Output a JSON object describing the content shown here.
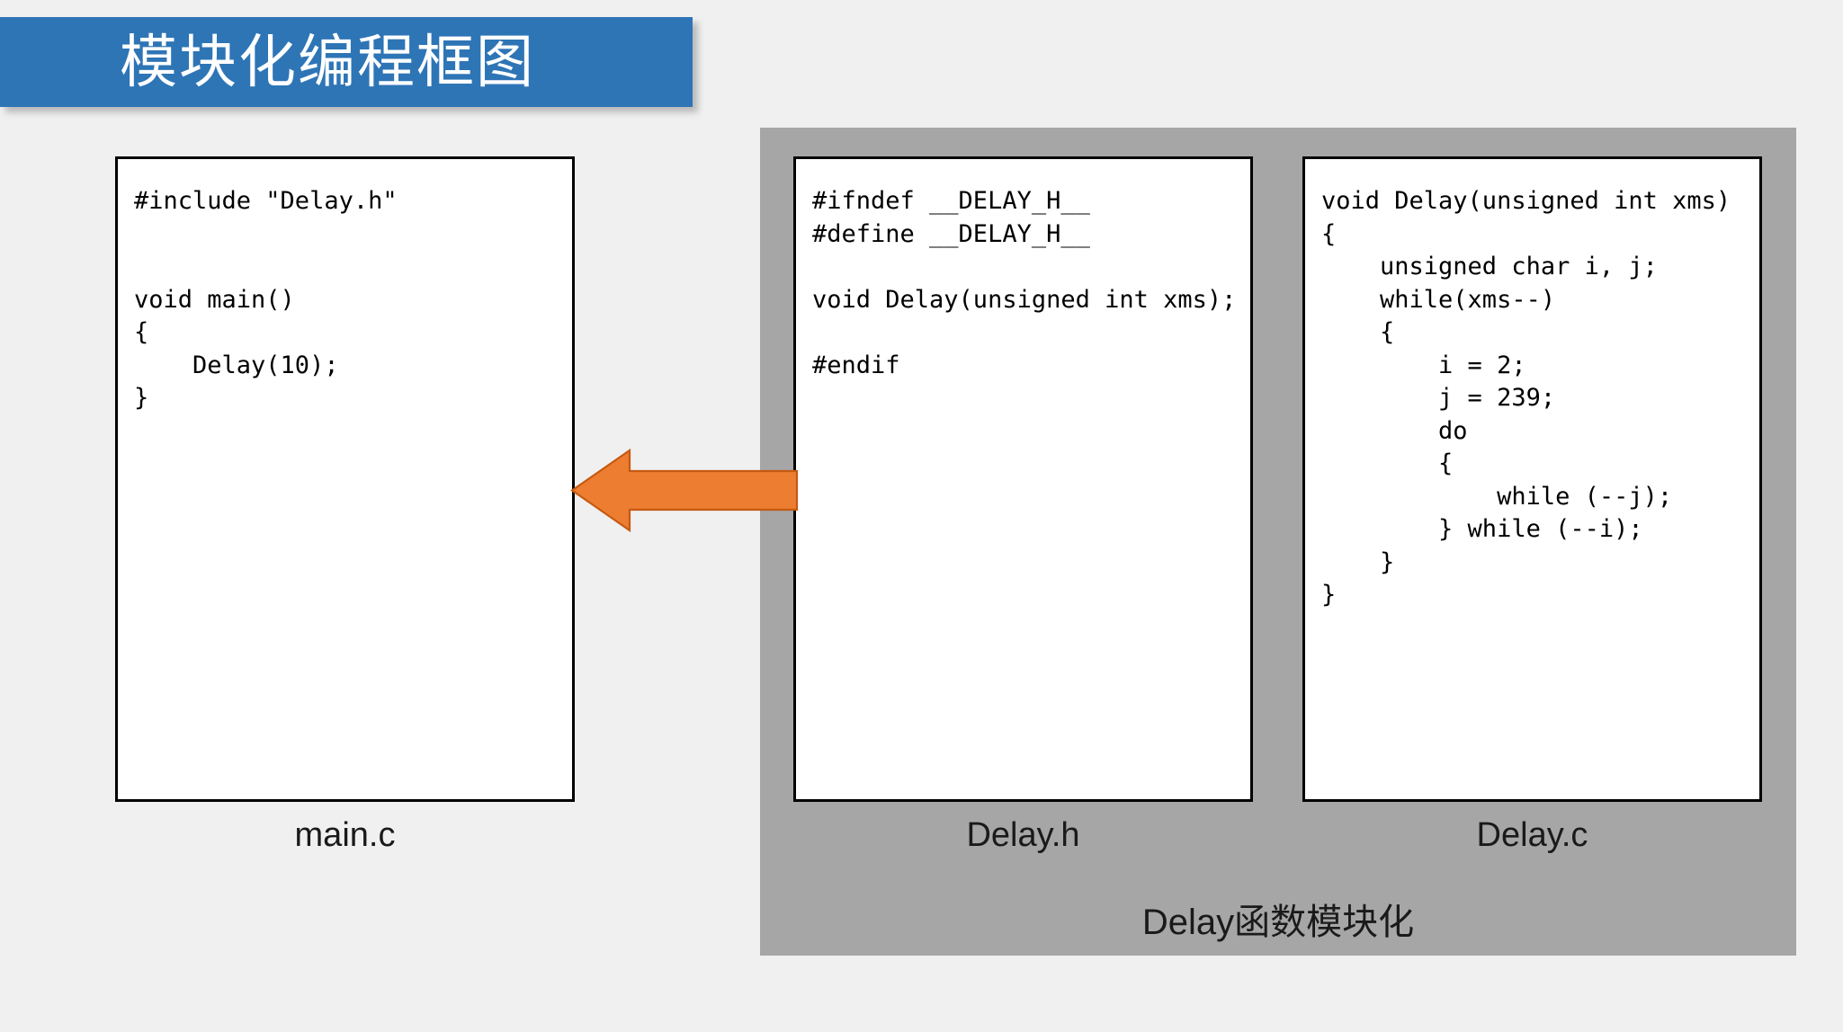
{
  "slide": {
    "title": "模块化编程框图",
    "background_color": "#f0f0f0"
  },
  "colors": {
    "title_banner": "#2E75B6",
    "title_text": "#FFFFFF",
    "module_panel": "#A6A6A6",
    "arrow_fill": "#ED7D31",
    "arrow_stroke": "#C55A11",
    "box_border": "#000000",
    "box_fill": "#FFFFFF"
  },
  "boxes": [
    {
      "id": "main-c",
      "caption": "main.c",
      "code": "#include \"Delay.h\"\n\n\nvoid main()\n{\n    Delay(10);\n}"
    },
    {
      "id": "delay-h",
      "caption": "Delay.h",
      "code": "#ifndef __DELAY_H__\n#define __DELAY_H__\n\nvoid Delay(unsigned int xms);\n\n#endif"
    },
    {
      "id": "delay-c",
      "caption": "Delay.c",
      "code": "void Delay(unsigned int xms)\n{\n    unsigned char i, j;\n    while(xms--)\n    {\n        i = 2;\n        j = 239;\n        do\n        {\n            while (--j);\n        } while (--i);\n    }\n}"
    }
  ],
  "module_panel": {
    "caption": "Delay函数模块化"
  },
  "arrow": {
    "direction": "left",
    "semantic": "include-dependency-arrow"
  }
}
